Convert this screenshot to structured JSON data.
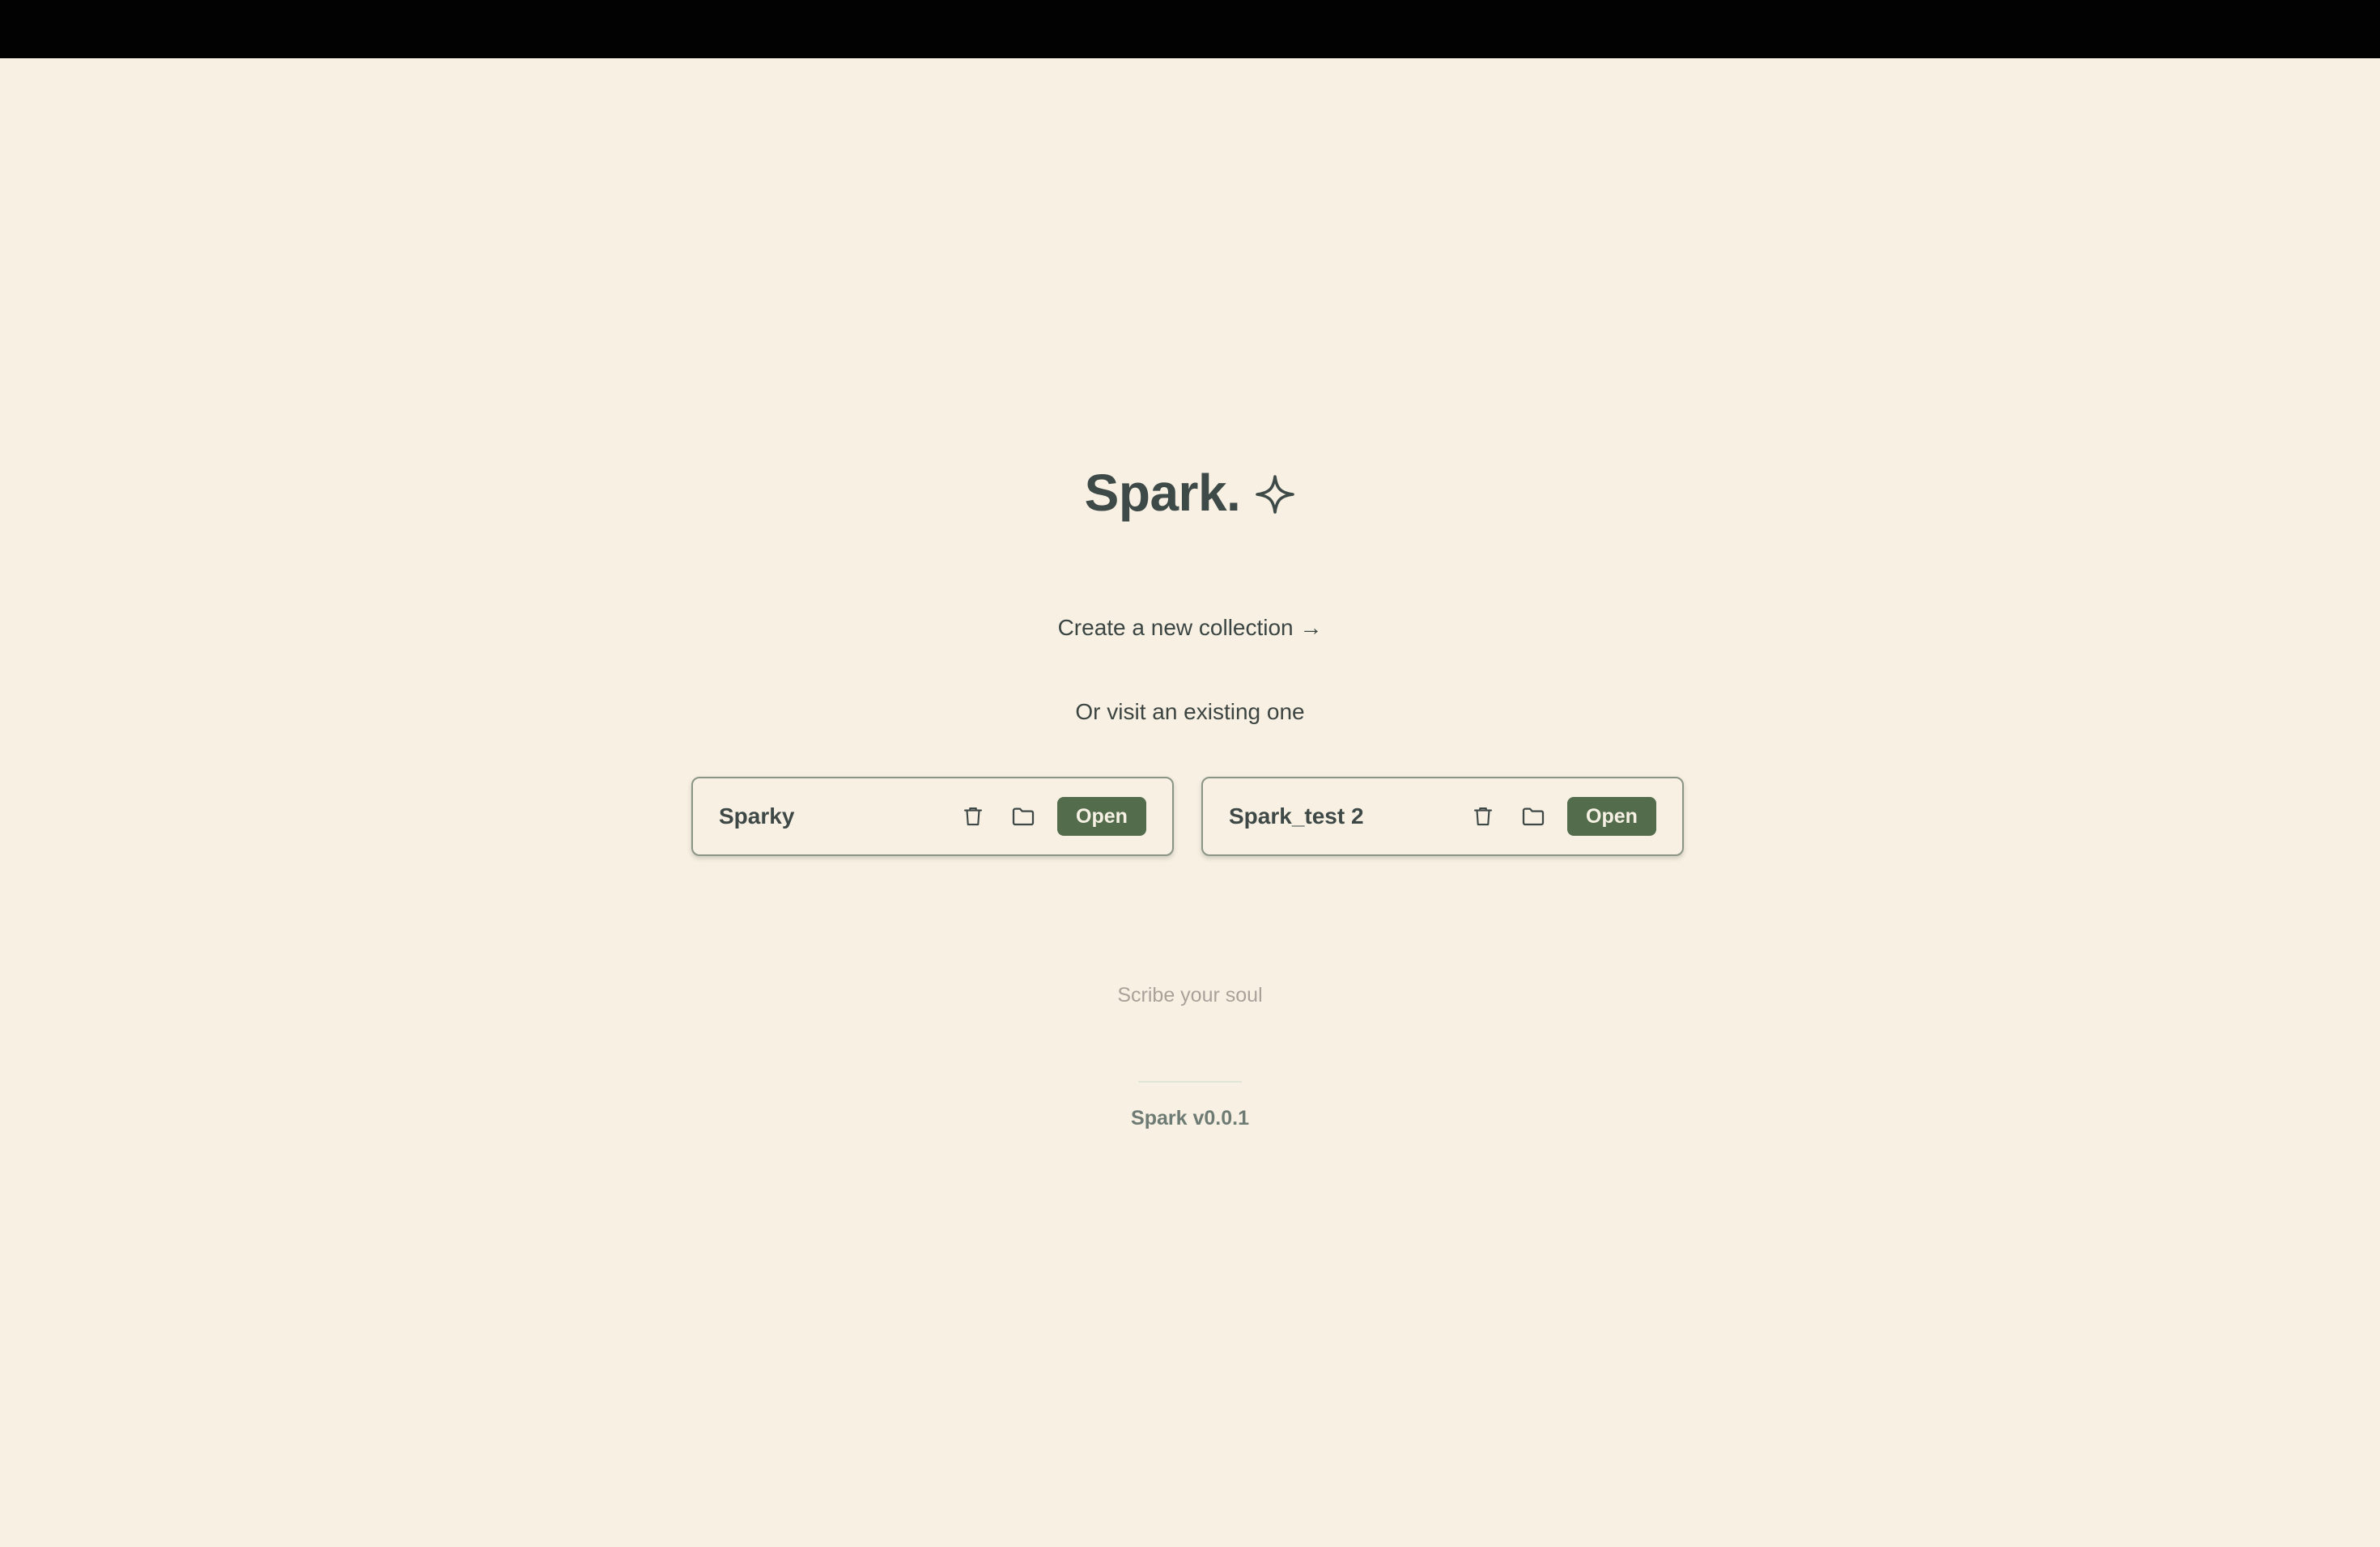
{
  "app": {
    "title": "Spark.",
    "title_icon": "sparkle-icon"
  },
  "actions": {
    "create_label": "Create a new collection →",
    "visit_label": "Or visit an existing one"
  },
  "collections": [
    {
      "name": "Sparky",
      "delete_icon": "trash-icon",
      "folder_icon": "folder-icon",
      "open_label": "Open"
    },
    {
      "name": "Spark_test 2",
      "delete_icon": "trash-icon",
      "folder_icon": "folder-icon",
      "open_label": "Open"
    }
  ],
  "footer": {
    "tagline": "Scribe your soul",
    "version": "Spark v0.0.1"
  },
  "colors": {
    "background": "#f8f1e3",
    "topbar": "#020202",
    "accent": "#536d4c",
    "text": "#3e4a48",
    "muted": "#a8a29a"
  }
}
